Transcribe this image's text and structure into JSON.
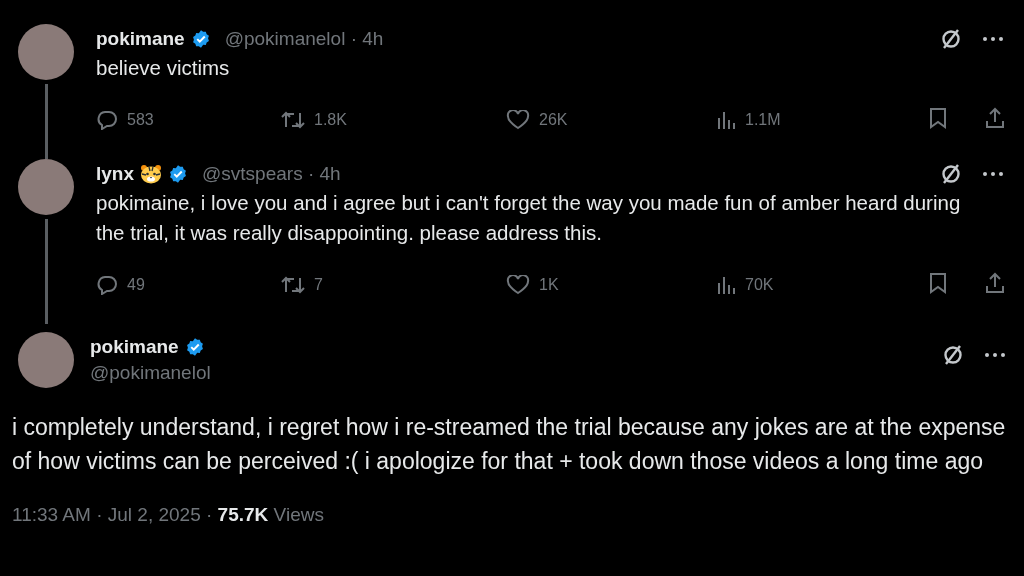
{
  "thread": [
    {
      "name": "pokimane",
      "has_tiger_emoji": false,
      "verified": true,
      "handle_line": "@pokimanelol · 4h",
      "text": "believe victims",
      "stats": {
        "replies": "583",
        "reposts": "1.8K",
        "likes": "26K",
        "views": "1.1M"
      }
    },
    {
      "name": "lynx",
      "has_tiger_emoji": true,
      "verified": true,
      "handle_line": "@svtspears · 4h",
      "text": "pokimaine, i love you and i agree but i can't forget the way you made fun of amber heard during the trial, it was really disappointing. please address this.",
      "stats": {
        "replies": "49",
        "reposts": "7",
        "likes": "1K",
        "views": "70K"
      }
    }
  ],
  "main_tweet": {
    "name": "pokimane",
    "verified": true,
    "handle": "@pokimanelol",
    "text": "i completely understand, i regret how i re-streamed the trial because any jokes are at the expense of how victims can be perceived :( i apologize for that + took down those videos a long time ago",
    "footer": "11:33 AM · Jul 2, 2025 · **75.7K** Views"
  }
}
